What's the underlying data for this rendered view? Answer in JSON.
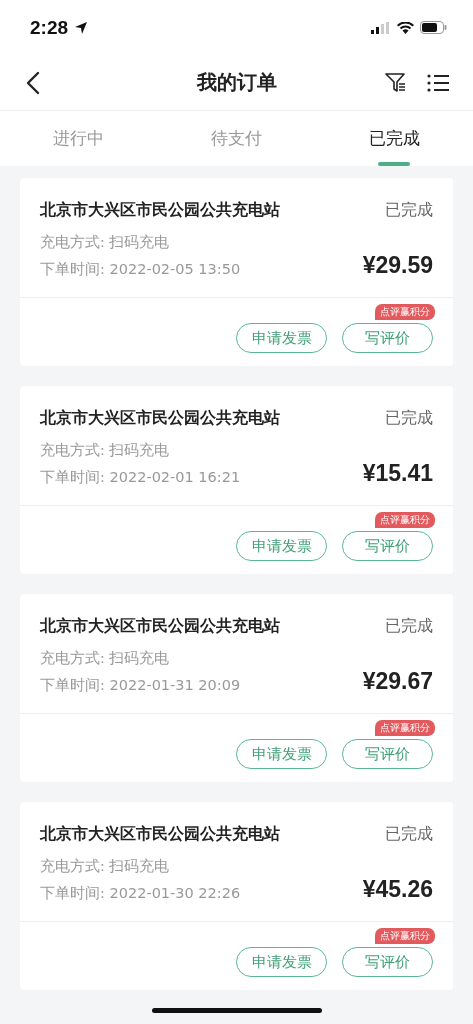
{
  "status_bar": {
    "time": "2:28"
  },
  "nav": {
    "title": "我的订单"
  },
  "tabs": [
    {
      "label": "进行中",
      "selected": false
    },
    {
      "label": "待支付",
      "selected": false
    },
    {
      "label": "已完成",
      "selected": true
    }
  ],
  "orders": [
    {
      "station": "北京市大兴区市民公园公共充电站",
      "status": "已完成",
      "method": "充电方式: 扫码充电",
      "time": "下单时间: 2022-02-05 13:50",
      "price": "¥29.59",
      "badge": "点评赢积分",
      "buttons": [
        "申请发票",
        "写评价"
      ]
    },
    {
      "station": "北京市大兴区市民公园公共充电站",
      "status": "已完成",
      "method": "充电方式: 扫码充电",
      "time": "下单时间: 2022-02-01 16:21",
      "price": "¥15.41",
      "badge": "点评赢积分",
      "buttons": [
        "申请发票",
        "写评价"
      ]
    },
    {
      "station": "北京市大兴区市民公园公共充电站",
      "status": "已完成",
      "method": "充电方式: 扫码充电",
      "time": "下单时间: 2022-01-31 20:09",
      "price": "¥29.67",
      "badge": "点评赢积分",
      "buttons": [
        "申请发票",
        "写评价"
      ]
    },
    {
      "station": "北京市大兴区市民公园公共充电站",
      "status": "已完成",
      "method": "充电方式: 扫码充电",
      "time": "下单时间: 2022-01-30 22:26",
      "price": "¥45.26",
      "badge": "点评赢积分",
      "buttons": [
        "申请发票",
        "写评价"
      ]
    }
  ]
}
